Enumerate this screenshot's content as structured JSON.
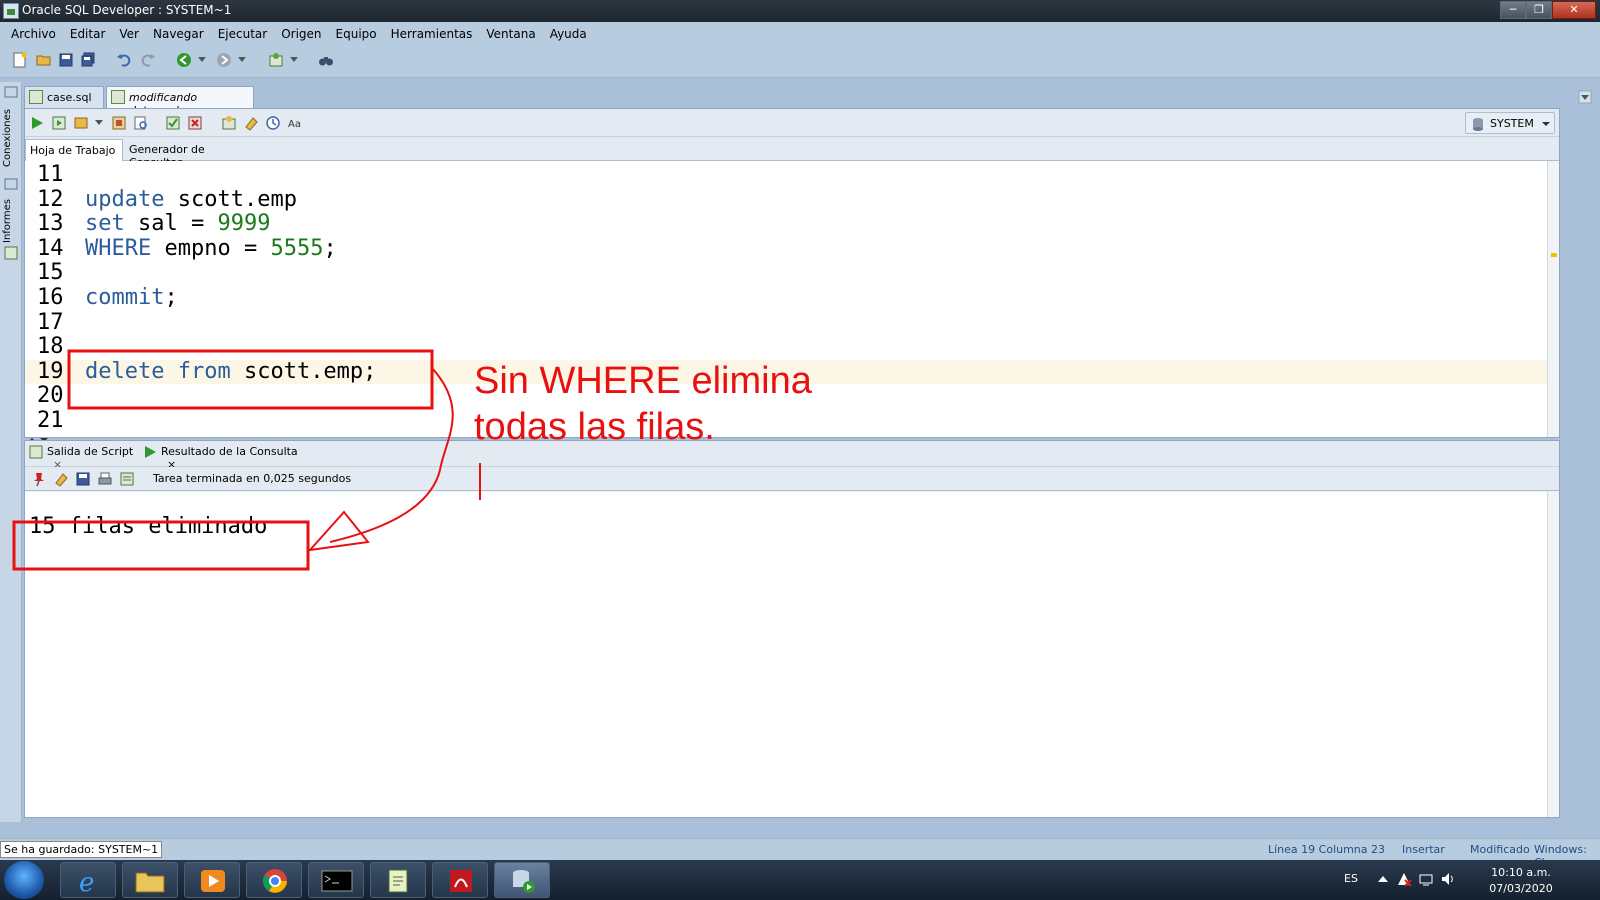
{
  "window": {
    "title": "Oracle SQL Developer : SYSTEM~1",
    "controls": [
      "─",
      "❐",
      "✕"
    ]
  },
  "menu": [
    "Archivo",
    "Editar",
    "Ver",
    "Navegar",
    "Ejecutar",
    "Origen",
    "Equipo",
    "Herramientas",
    "Ventana",
    "Ayuda"
  ],
  "left_strip": {
    "tabs": [
      "Conexiones",
      "Informes"
    ]
  },
  "doc_tabs": [
    {
      "label": "case.sql",
      "active": false
    },
    {
      "label": "modificando datos.sql",
      "active": true
    }
  ],
  "tab_close": "×",
  "editor": {
    "subtabs": [
      "Hoja de Trabajo",
      "Generador de Consultas"
    ],
    "connection": "SYSTEM",
    "lines": [
      {
        "n": "11",
        "tokens": []
      },
      {
        "n": "12",
        "tokens": [
          {
            "t": "update",
            "c": "kw"
          },
          {
            "t": " scott.emp",
            "c": "plain"
          }
        ]
      },
      {
        "n": "13",
        "tokens": [
          {
            "t": "set",
            "c": "kw"
          },
          {
            "t": " sal = ",
            "c": "plain"
          },
          {
            "t": "9999",
            "c": "num"
          }
        ]
      },
      {
        "n": "14",
        "tokens": [
          {
            "t": "WHERE",
            "c": "kw"
          },
          {
            "t": " empno = ",
            "c": "plain"
          },
          {
            "t": "5555",
            "c": "num"
          },
          {
            "t": ";",
            "c": "plain"
          }
        ]
      },
      {
        "n": "15",
        "tokens": []
      },
      {
        "n": "16",
        "tokens": [
          {
            "t": "commit",
            "c": "kw"
          },
          {
            "t": ";",
            "c": "plain"
          }
        ]
      },
      {
        "n": "17",
        "tokens": []
      },
      {
        "n": "18",
        "tokens": []
      },
      {
        "n": "19",
        "tokens": [
          {
            "t": "delete",
            "c": "kw"
          },
          {
            "t": " ",
            "c": "plain"
          },
          {
            "t": "from",
            "c": "kw"
          },
          {
            "t": " scott.emp;",
            "c": "plain"
          }
        ],
        "highlight": true
      },
      {
        "n": "20",
        "tokens": []
      },
      {
        "n": "21",
        "tokens": []
      }
    ]
  },
  "output": {
    "tabs": [
      "Salida de Script",
      "Resultado de la Consulta"
    ],
    "status": "Tarea terminada en 0,025 segundos",
    "text": "15 filas eliminado"
  },
  "annotation": {
    "text_line1": "Sin WHERE elimina",
    "text_line2": "todas las filas.",
    "color": "#e81010"
  },
  "statusbar": {
    "saved": "Se ha guardado: SYSTEM~1",
    "position": "Línea 19 Columna 23",
    "mode": "Insertar",
    "modified": "Modificado",
    "encoding": "Windows: Cl"
  },
  "taskbar": {
    "lang": "ES",
    "time": "10:10 a.m.",
    "date": "07/03/2020"
  },
  "colors": {
    "keyword": "#2b5d99",
    "number": "#1a7a1a",
    "accent": "#b8cce0"
  }
}
